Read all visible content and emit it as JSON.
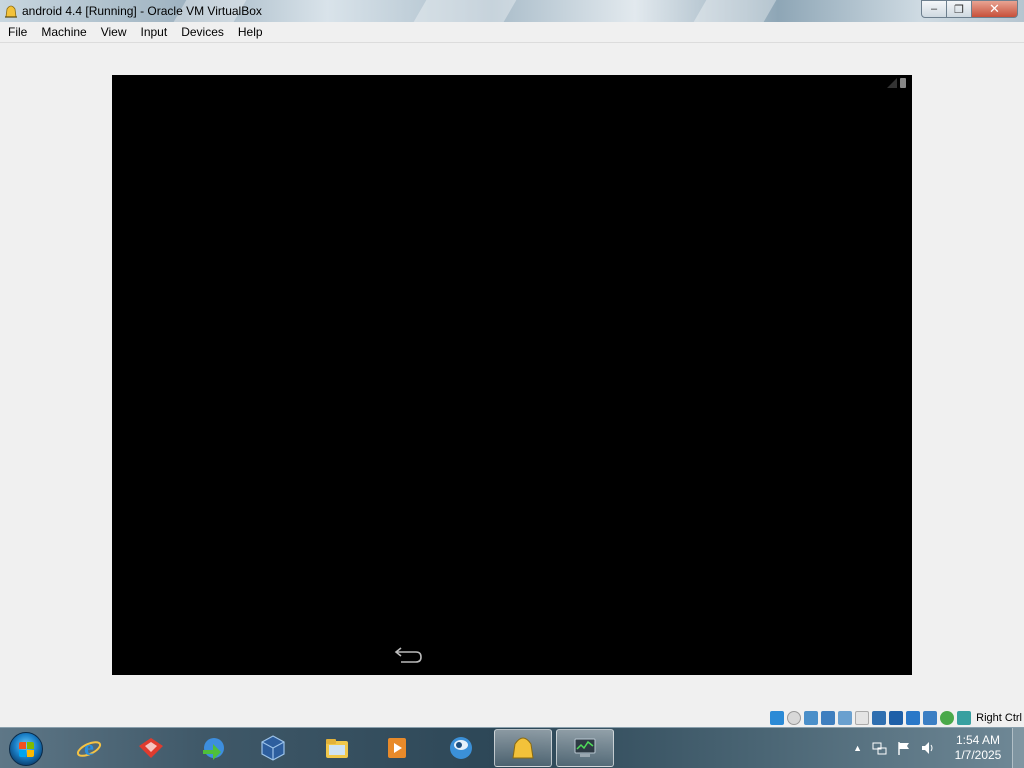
{
  "window": {
    "title": "android 4.4 [Running] - Oracle VM VirtualBox",
    "controls": {
      "minimize": "–",
      "maximize": "❐",
      "close": "✕"
    }
  },
  "menu": [
    "File",
    "Machine",
    "View",
    "Input",
    "Devices",
    "Help"
  ],
  "vm": {
    "screen_color": "#000000",
    "nav_icon": "back-arrow-icon"
  },
  "status_bar": {
    "icons": [
      "hard-disk-icon",
      "optical-drive-icon",
      "usb-icon",
      "network-icon",
      "shared-folders-icon",
      "display-icon",
      "video-capture-icon",
      "snapshot-icon",
      "mouse-integration-icon",
      "keyboard-icon",
      "virtualization-icon",
      "cpu-icon"
    ],
    "host_key": "Right Ctrl"
  },
  "taskbar": {
    "apps": [
      "internet-explorer-icon",
      "lasso-app-icon",
      "download-manager-icon",
      "virtualbox-icon",
      "file-explorer-icon",
      "media-player-icon",
      "globe-app-icon",
      "virtualbox-vm-icon",
      "network-monitor-icon"
    ],
    "clock": {
      "time": "1:54 AM",
      "date": "1/7/2025"
    }
  }
}
